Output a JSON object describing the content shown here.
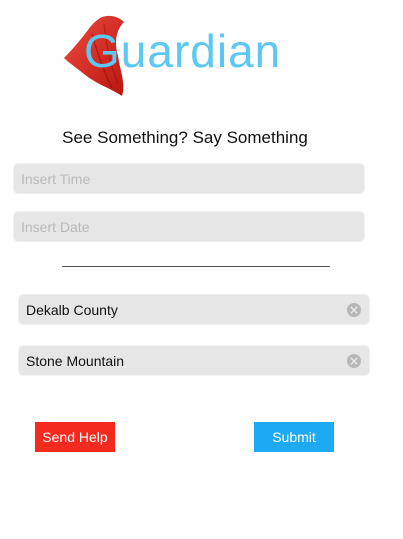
{
  "app": {
    "logo_text": "Guardian",
    "logo_icon": "red-cape-icon",
    "brand_color": "#5bc8f5",
    "cape_color": "#e0281d"
  },
  "header": {
    "title": "See Something? Say Something"
  },
  "form": {
    "time": {
      "placeholder": "Insert Time",
      "value": ""
    },
    "date": {
      "placeholder": "Insert Date",
      "value": ""
    },
    "county": {
      "value": "Dekalb County",
      "clear_icon": "clear-circle-icon"
    },
    "city": {
      "value": "Stone Mountain",
      "clear_icon": "clear-circle-icon"
    }
  },
  "actions": {
    "send_help_label": "Send Help",
    "send_help_color": "#f52a1f",
    "submit_label": "Submit",
    "submit_color": "#1daaf2"
  }
}
